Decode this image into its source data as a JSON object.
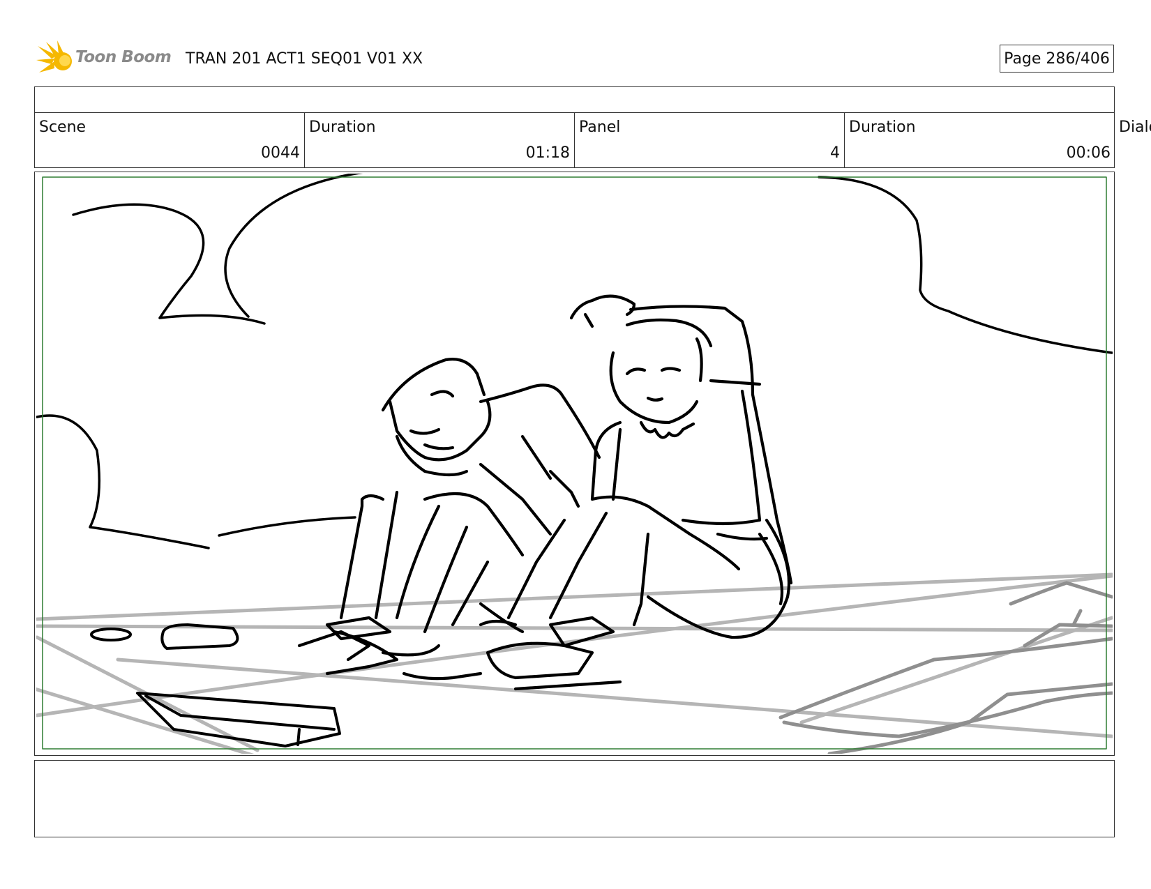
{
  "header": {
    "logo_text": "Toon Boom",
    "document_title": "TRAN 201 ACT1 SEQ01 V01 XX",
    "page_indicator": "Page 286/406"
  },
  "info": {
    "scene_label": "Scene",
    "scene_value": "0044",
    "scene_duration_label": "Duration",
    "scene_duration_value": "01:18",
    "panel_label": "Panel",
    "panel_value": "4",
    "panel_duration_label": "Duration",
    "panel_duration_value": "00:06",
    "dialog_label": "Dialo"
  },
  "colors": {
    "logo_star": "#f5b800",
    "logo_text": "#8a8a8a",
    "safe_frame": "#2e7d32",
    "sketch_line": "#000000",
    "sketch_ground": "#b5b5b5"
  },
  "icons": {
    "logo": "starburst-logo-icon"
  },
  "notes": {
    "text": ""
  }
}
